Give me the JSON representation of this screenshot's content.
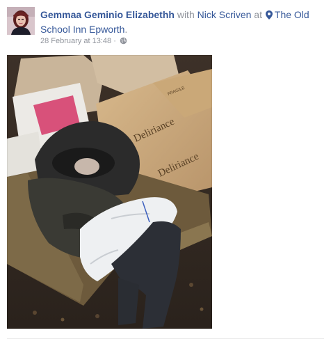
{
  "post": {
    "author": "Gemmaa Geminio Elizabethh",
    "with_text": " with ",
    "tagged_person": "Nick Scriven",
    "at_text": " at ",
    "location": "The Old School Inn Epworth",
    "after_location": ".",
    "timestamp": "28 February at 13:48",
    "separator": "·",
    "privacy_icon": "globe-icon",
    "location_icon": "map-pin-icon"
  },
  "photo": {
    "box_brand_1": "Deliriance",
    "box_brand_2": "Deliriance",
    "box_label": "FRAGILE"
  },
  "colors": {
    "link": "#365899",
    "meta_text": "#90949c",
    "divider": "#e5e5e5"
  }
}
